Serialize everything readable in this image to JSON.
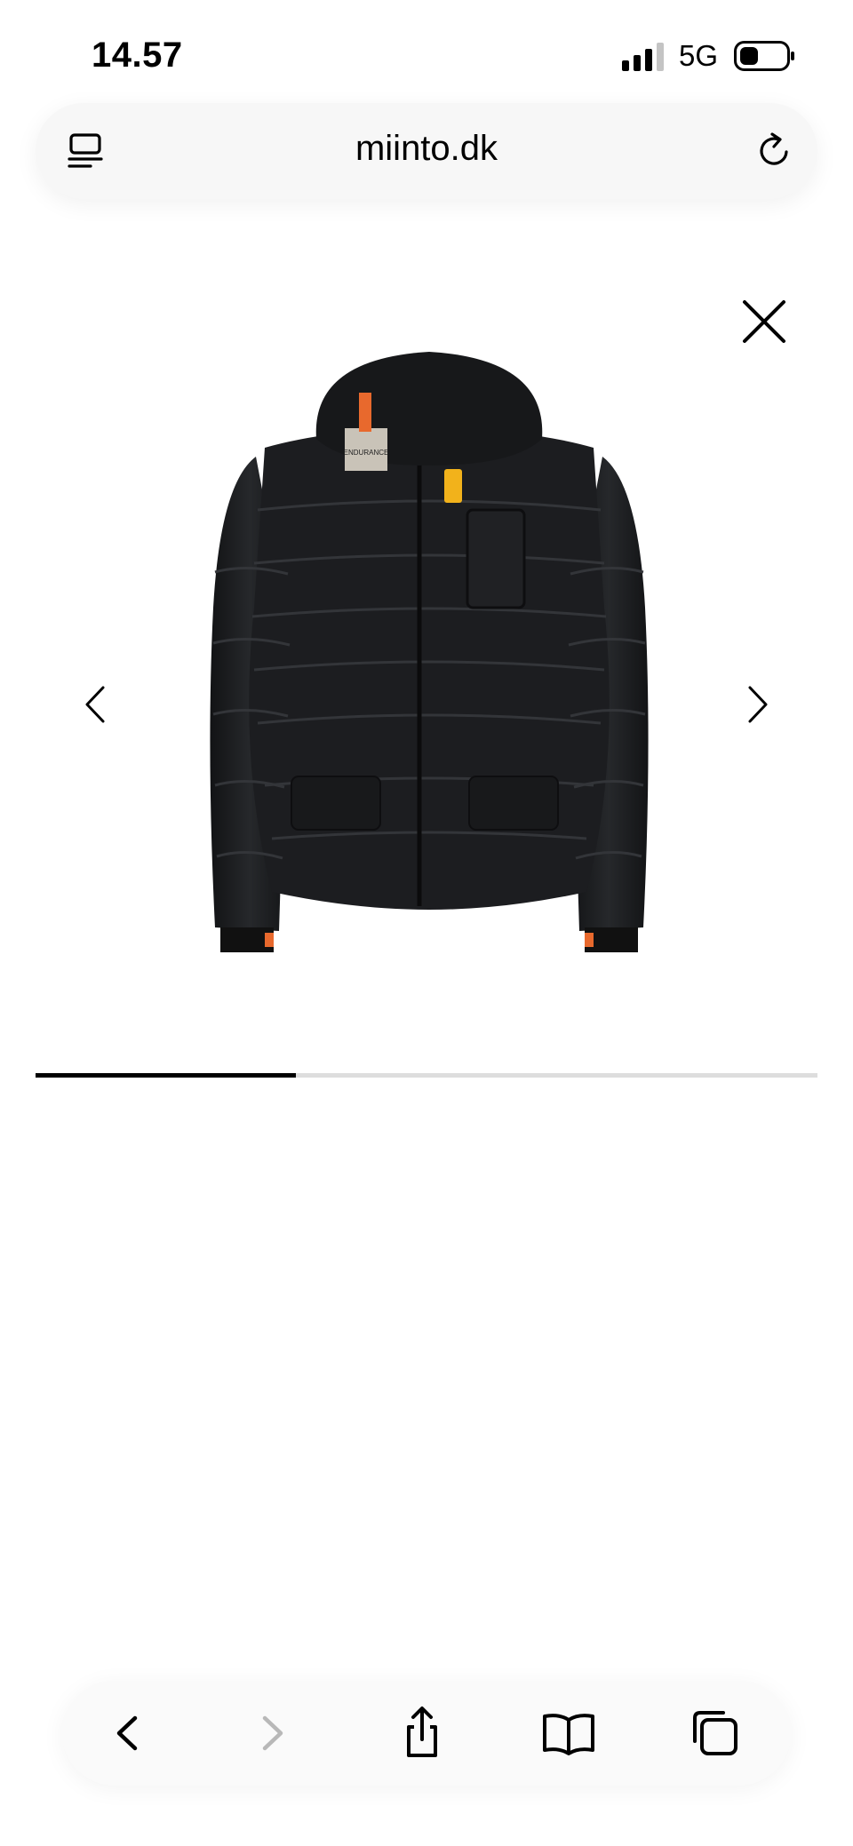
{
  "status_bar": {
    "time": "14.57",
    "network": "5G",
    "icons": [
      "signal-bars-icon",
      "battery-icon"
    ]
  },
  "browser": {
    "url": "miinto.dk",
    "left_icon": "reader-view-icon",
    "right_icon": "reload-icon"
  },
  "gallery": {
    "close_icon": "close-icon",
    "prev_icon": "chevron-left-icon",
    "next_icon": "chevron-right-icon",
    "image_alt": "Black quilted down jacket with hood",
    "brand_patch_text": "ENDURANCE",
    "progress_fraction": 0.333,
    "colors": {
      "progress_fill": "#000000",
      "progress_track": "#dddddd",
      "jacket": "#1b1c1e",
      "accent_orange": "#e8692d",
      "accent_yellow": "#f2b21b"
    }
  },
  "toolbar": {
    "buttons": [
      {
        "name": "back",
        "icon": "chevron-left-icon",
        "enabled": true
      },
      {
        "name": "forward",
        "icon": "chevron-right-icon",
        "enabled": false
      },
      {
        "name": "share",
        "icon": "share-icon",
        "enabled": true
      },
      {
        "name": "bookmarks",
        "icon": "book-icon",
        "enabled": true
      },
      {
        "name": "tabs",
        "icon": "tabs-icon",
        "enabled": true
      }
    ]
  }
}
